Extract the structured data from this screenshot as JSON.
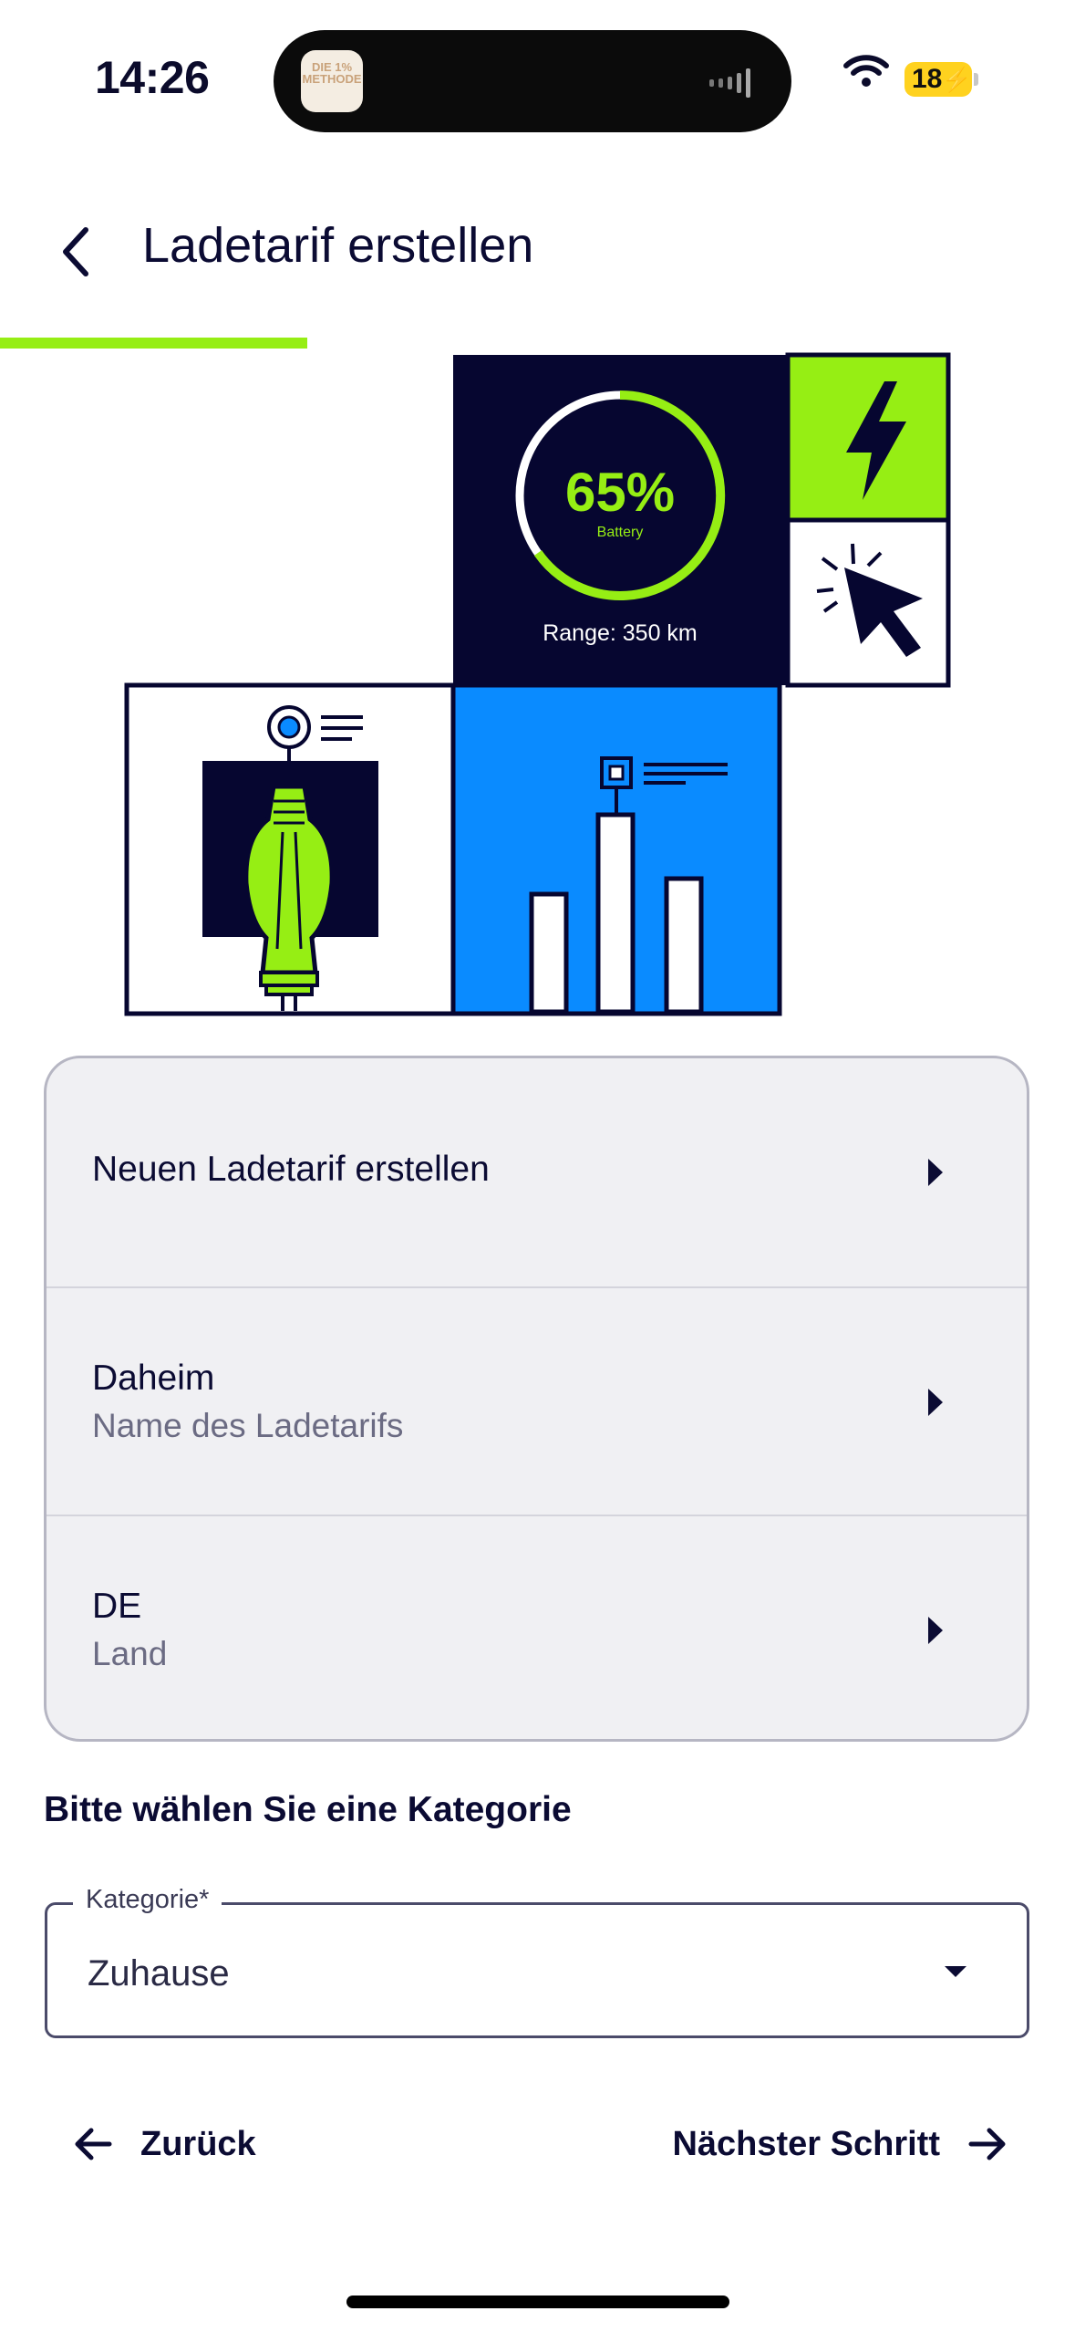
{
  "status_bar": {
    "time": "14:26",
    "battery": "18"
  },
  "dynamic_island": {
    "app_icon_text": "DIE 1% METHODE"
  },
  "header": {
    "title": "Ladetarif erstellen",
    "progress": 0.286
  },
  "illustration": {
    "battery_percent": "65%",
    "battery_label": "Battery",
    "range": "Range: 350 km"
  },
  "list": {
    "rows": [
      {
        "title": "Neuen Ladetarif erstellen",
        "subtitle": ""
      },
      {
        "title": "Daheim",
        "subtitle": "Name des Ladetarifs"
      },
      {
        "title": "DE",
        "subtitle": "Land"
      }
    ]
  },
  "category": {
    "prompt": "Bitte wählen Sie eine Kategorie",
    "label": "Kategorie*",
    "value": "Zuhause"
  },
  "footer": {
    "back_label": "Zurück",
    "next_label": "Nächster Schritt"
  },
  "colors": {
    "accent": "#96ee14",
    "navy": "#0b0b33",
    "blue": "#0a8bff"
  }
}
